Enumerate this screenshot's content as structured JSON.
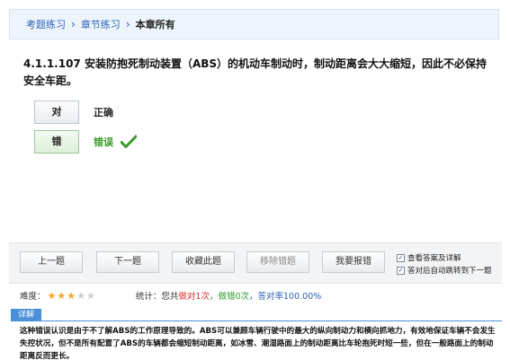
{
  "breadcrumb": {
    "items": [
      "考题练习",
      "章节练习",
      "本章所有"
    ],
    "separator": "›"
  },
  "question": {
    "text": "4.1.1.107 安装防抱死制动装置（ABS）的机动车制动时，制动距离会大大缩短，因此不必保持安全车距。"
  },
  "options": [
    {
      "button_label": "对",
      "text": "正确",
      "selected": false
    },
    {
      "button_label": "错",
      "text": "错误",
      "selected": true,
      "icon": "check-icon"
    }
  ],
  "actions": {
    "prev": "上一题",
    "next": "下一题",
    "favorite": "收藏此题",
    "remove_wrong": "移除错题",
    "report": "我要报错",
    "show_answer": "查看答案及详解",
    "auto_next": "答对后自动跳转到下一题"
  },
  "stats": {
    "difficulty_label": "难度：",
    "difficulty": 3,
    "difficulty_max": 5,
    "stats_label": "统计：",
    "prefix": "您共",
    "correct": "做对1次",
    "wrong_sep": "，做错0次",
    "rate_sep": "，答对率100.00%"
  },
  "explanation": {
    "tag": "详解",
    "text": "这种错误认识是由于不了解ABS的工作原理导致的。ABS可以兼顾车辆行驶中的最大的纵向制动力和横向抓地力，有效地保证车辆不会发生失控状况，但不是所有配置了ABS的车辆都会缩短制动距离，如冰雪、潮湿路面上的制动距离比车轮抱死时短一些，但在一般路面上的制动距离反而更长。"
  },
  "colors": {
    "link": "#2a64b6",
    "correct": "#d9302c",
    "wrong_count": "#2b9b2b",
    "accent": "#4a8fd8",
    "check": "#3a9a2a"
  }
}
